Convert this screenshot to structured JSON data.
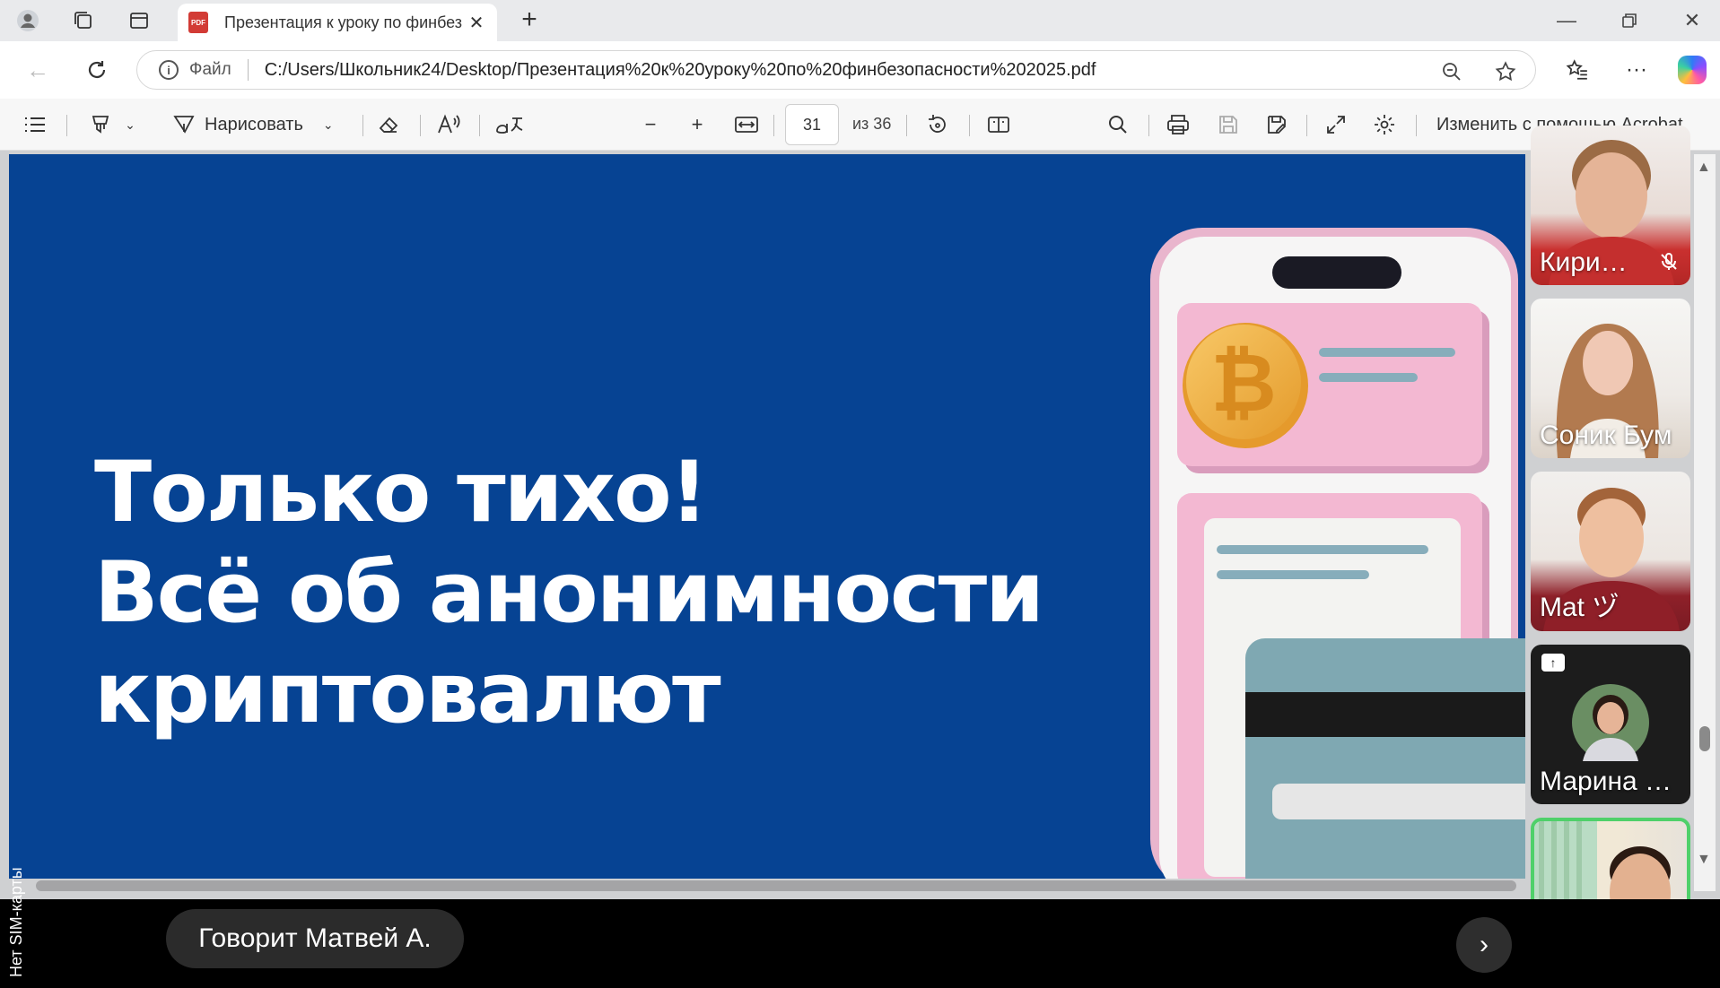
{
  "browser": {
    "tab_title": "Презентация к уроку по финбез",
    "tab_favicon_text": "PDF",
    "address_label": "Файл",
    "url": "C:/Users/Школьник24/Desktop/Презентация%20к%20уроку%20по%20финбезопасности%202025.pdf"
  },
  "pdf_toolbar": {
    "draw_label": "Нарисовать",
    "current_page": "31",
    "total_pages_label": "из 36",
    "acrobat_label": "Изменить с помощью Acrobat"
  },
  "slide": {
    "line1": "Только тихо!",
    "line2": "Всё об анонимности",
    "line3": "криптовалют"
  },
  "participants": [
    {
      "name": "Кири…"
    },
    {
      "name": "Соник Бум"
    },
    {
      "name": "Mat ヅ"
    },
    {
      "name": "Марина …"
    },
    {
      "name": ""
    }
  ],
  "call": {
    "speaker_text": "Говорит Матвей А.",
    "next_label": "›"
  },
  "status": {
    "text": "Нет SIM-карты"
  },
  "colors": {
    "slide_bg": "#064393",
    "active_speaker_border": "#4fd06a"
  }
}
